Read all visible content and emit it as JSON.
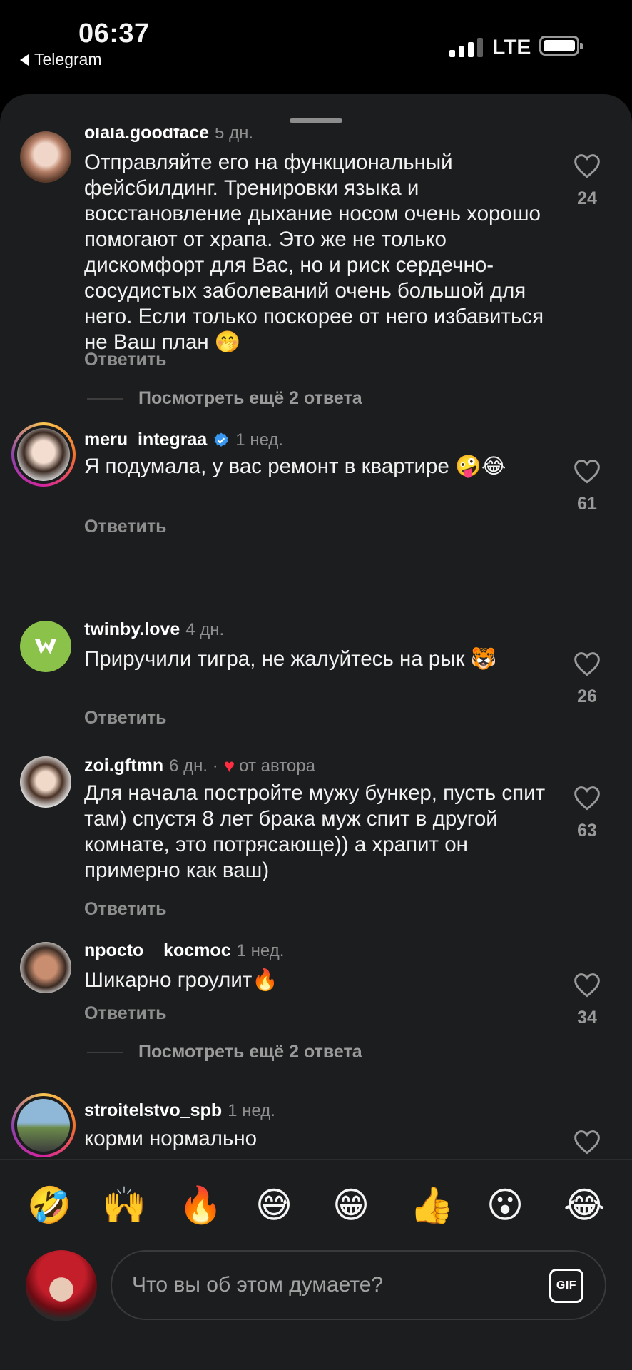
{
  "status_bar": {
    "time": "06:37",
    "back_app": "Telegram",
    "network": "LTE"
  },
  "comments": [
    {
      "username": "olala.goodface",
      "ago": "5 дн.",
      "text": "Отправляйте его на функциональный фейсбилдинг. Тренировки языка и восстановление дыхание носом очень хорошо помогают от храпа. Это же не только дискомфорт для Вас, но и риск сердечно-сосудистых заболеваний очень большой для него. Если только поскорее от него избавиться не Ваш план 🤭",
      "reply": "Ответить",
      "likes": "24",
      "more_replies": "Посмотреть ещё 2 ответа"
    },
    {
      "username": "meru_integraa",
      "ago": "1 нед.",
      "text": "Я подумала, у вас ремонт в квартире 🤪😂",
      "reply": "Ответить",
      "likes": "61"
    },
    {
      "username": "twinby.love",
      "ago": "4 дн.",
      "text": "Приручили тигра, не жалуйтесь на рык 🐯",
      "reply": "Ответить",
      "likes": "26"
    },
    {
      "username": "zoi.gftmn",
      "ago": "6 дн. ·",
      "author_label": "от автора",
      "text": "Для начала постройте мужу бункер, пусть спит там) спустя 8 лет брака муж спит в другой комнате, это потрясающе)) а храпит он примерно как ваш)",
      "reply": "Ответить",
      "likes": "63"
    },
    {
      "username": "npocto__kocmoc",
      "ago": "1 нед.",
      "text": "Шикарно гроулит🔥",
      "reply": "Ответить",
      "likes": "34",
      "more_replies": "Посмотреть ещё 2 ответа"
    },
    {
      "username": "stroitelstvo_spb",
      "ago": "1 нед.",
      "text": "корми нормально"
    }
  ],
  "quick_emojis": [
    "🤣",
    "🙌",
    "🔥",
    "😅",
    "😁",
    "👍",
    "😮",
    "😂"
  ],
  "composer": {
    "placeholder": "Что вы об этом думаете?",
    "gif_label": "GIF"
  },
  "colors": {
    "background": "#1c1d1f",
    "muted": "#8e8e8e",
    "author_heart": "#ff2d3f",
    "verified": "#3897f0"
  }
}
